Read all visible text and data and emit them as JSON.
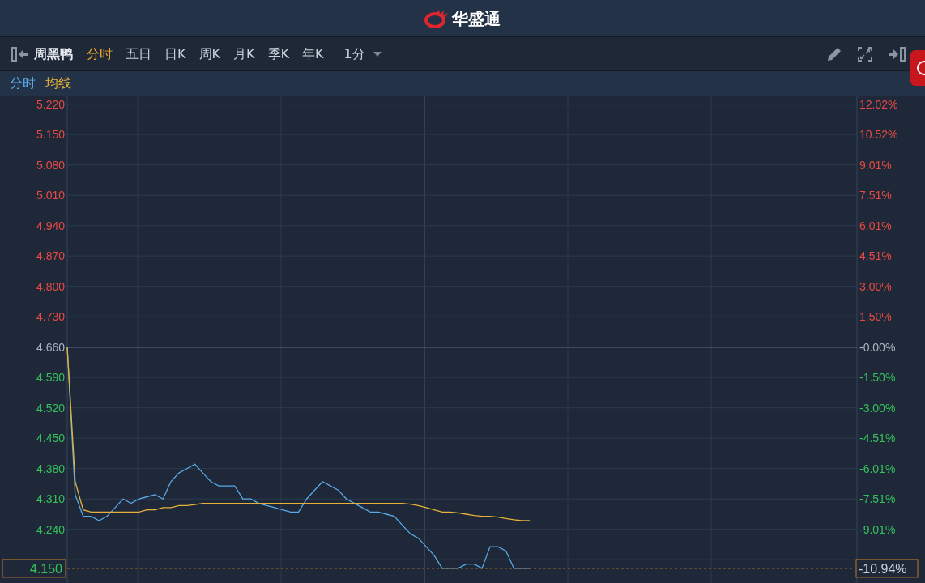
{
  "header": {
    "brand": "华盛通"
  },
  "toolbar": {
    "stock_name": "周黑鸭",
    "tabs": [
      {
        "label": "分时",
        "selected": true
      },
      {
        "label": "五日",
        "selected": false
      },
      {
        "label": "日K",
        "selected": false
      },
      {
        "label": "周K",
        "selected": false
      },
      {
        "label": "月K",
        "selected": false
      },
      {
        "label": "季K",
        "selected": false
      },
      {
        "label": "年K",
        "selected": false
      }
    ],
    "interval": "1分"
  },
  "chart_data": {
    "type": "line",
    "ylim": [
      4.12,
      5.24
    ],
    "categories": [
      null,
      null,
      null,
      null,
      null,
      null,
      null,
      null,
      null,
      null,
      null,
      null,
      null,
      null,
      null,
      null,
      null,
      null,
      null,
      null,
      null,
      null,
      null,
      null,
      null,
      null,
      null,
      null,
      null,
      null,
      null,
      null,
      null,
      null,
      null,
      null,
      null,
      null,
      null,
      null,
      null,
      null,
      null,
      null,
      null,
      null,
      null,
      null,
      null,
      null,
      null,
      null,
      null,
      null,
      null,
      null,
      null,
      null,
      null,
      null,
      null,
      null,
      null,
      null,
      null,
      null,
      null,
      null,
      null,
      null,
      null,
      null,
      null,
      null,
      null,
      null,
      null,
      null,
      null,
      null,
      null,
      null,
      null,
      null,
      null,
      null,
      null,
      null,
      null,
      null,
      null,
      null,
      null,
      null,
      null,
      null,
      null,
      null,
      null,
      null
    ],
    "series": [
      {
        "name": "分时",
        "color": "#5aa9e6",
        "values": [
          4.66,
          4.32,
          4.27,
          4.27,
          4.26,
          4.27,
          4.29,
          4.31,
          4.3,
          4.31,
          4.315,
          4.32,
          4.31,
          4.35,
          4.37,
          4.38,
          4.39,
          4.37,
          4.35,
          4.34,
          4.34,
          4.34,
          4.31,
          4.31,
          4.3,
          4.295,
          4.29,
          4.285,
          4.28,
          4.28,
          4.31,
          4.33,
          4.35,
          4.34,
          4.33,
          4.31,
          4.3,
          4.29,
          4.28,
          4.28,
          4.275,
          4.27,
          4.25,
          4.23,
          4.22,
          4.2,
          4.18,
          4.15,
          4.15,
          4.15,
          4.16,
          4.16,
          4.15,
          4.2,
          4.2,
          4.19,
          4.15,
          4.15,
          4.15,
          null,
          null,
          null,
          null,
          null,
          null,
          null,
          null,
          null,
          null,
          null,
          null,
          null,
          null,
          null,
          null,
          null,
          null,
          null,
          null,
          null,
          null,
          null,
          null,
          null,
          null,
          null,
          null,
          null,
          null,
          null,
          null,
          null,
          null,
          null,
          null,
          null,
          null,
          null,
          null,
          null
        ]
      },
      {
        "name": "均线",
        "color": "#e5b13a",
        "values": [
          4.66,
          4.35,
          4.285,
          4.28,
          4.28,
          4.28,
          4.28,
          4.28,
          4.28,
          4.28,
          4.285,
          4.285,
          4.29,
          4.29,
          4.295,
          4.295,
          4.297,
          4.3,
          4.3,
          4.3,
          4.3,
          4.3,
          4.3,
          4.3,
          4.3,
          4.3,
          4.3,
          4.3,
          4.3,
          4.3,
          4.3,
          4.3,
          4.3,
          4.3,
          4.3,
          4.3,
          4.3,
          4.3,
          4.3,
          4.3,
          4.3,
          4.3,
          4.3,
          4.298,
          4.295,
          4.29,
          4.285,
          4.28,
          4.28,
          4.278,
          4.275,
          4.272,
          4.27,
          4.27,
          4.268,
          4.265,
          4.262,
          4.26,
          4.26,
          null,
          null,
          null,
          null,
          null,
          null,
          null,
          null,
          null,
          null,
          null,
          null,
          null,
          null,
          null,
          null,
          null,
          null,
          null,
          null,
          null,
          null,
          null,
          null,
          null,
          null,
          null,
          null,
          null,
          null,
          null,
          null,
          null,
          null,
          null,
          null,
          null,
          null,
          null,
          null,
          null
        ]
      }
    ],
    "yticks": [
      {
        "value": 5.22,
        "label": "5.220"
      },
      {
        "value": 5.15,
        "label": "5.150"
      },
      {
        "value": 5.08,
        "label": "5.080"
      },
      {
        "value": 5.01,
        "label": "5.010"
      },
      {
        "value": 4.94,
        "label": "4.940"
      },
      {
        "value": 4.87,
        "label": "4.870"
      },
      {
        "value": 4.8,
        "label": "4.800"
      },
      {
        "value": 4.73,
        "label": "4.730"
      },
      {
        "value": 4.66,
        "label": "4.660"
      },
      {
        "value": 4.59,
        "label": "4.590"
      },
      {
        "value": 4.52,
        "label": "4.520"
      },
      {
        "value": 4.45,
        "label": "4.450"
      },
      {
        "value": 4.38,
        "label": "4.380"
      },
      {
        "value": 4.31,
        "label": "4.310"
      },
      {
        "value": 4.24,
        "label": "4.240"
      }
    ],
    "grid": true,
    "ref_lines": [
      {
        "axis": "y",
        "value": 4.66
      },
      {
        "axis": "y",
        "value": 4.15,
        "label": "4.150",
        "color": "#c0782a"
      }
    ]
  },
  "percent_axis": {
    "labels": [
      {
        "text": "12.02%",
        "color": "#e84a43"
      },
      {
        "text": "10.52%",
        "color": "#e84a43"
      },
      {
        "text": "9.01%",
        "color": "#e84a43"
      },
      {
        "text": "7.51%",
        "color": "#e84a43"
      },
      {
        "text": "6.01%",
        "color": "#e84a43"
      },
      {
        "text": "4.51%",
        "color": "#e84a43"
      },
      {
        "text": "3.00%",
        "color": "#e84a43"
      },
      {
        "text": "1.50%",
        "color": "#e84a43"
      },
      {
        "text": "-0.00%",
        "color": "#aab4c3"
      },
      {
        "text": "-1.50%",
        "color": "#35c05a"
      },
      {
        "text": "-3.00%",
        "color": "#35c05a"
      },
      {
        "text": "-4.51%",
        "color": "#35c05a"
      },
      {
        "text": "-6.01%",
        "color": "#35c05a"
      },
      {
        "text": "-7.51%",
        "color": "#35c05a"
      },
      {
        "text": "-9.01%",
        "color": "#35c05a"
      }
    ],
    "last_change": "-10.94%"
  }
}
